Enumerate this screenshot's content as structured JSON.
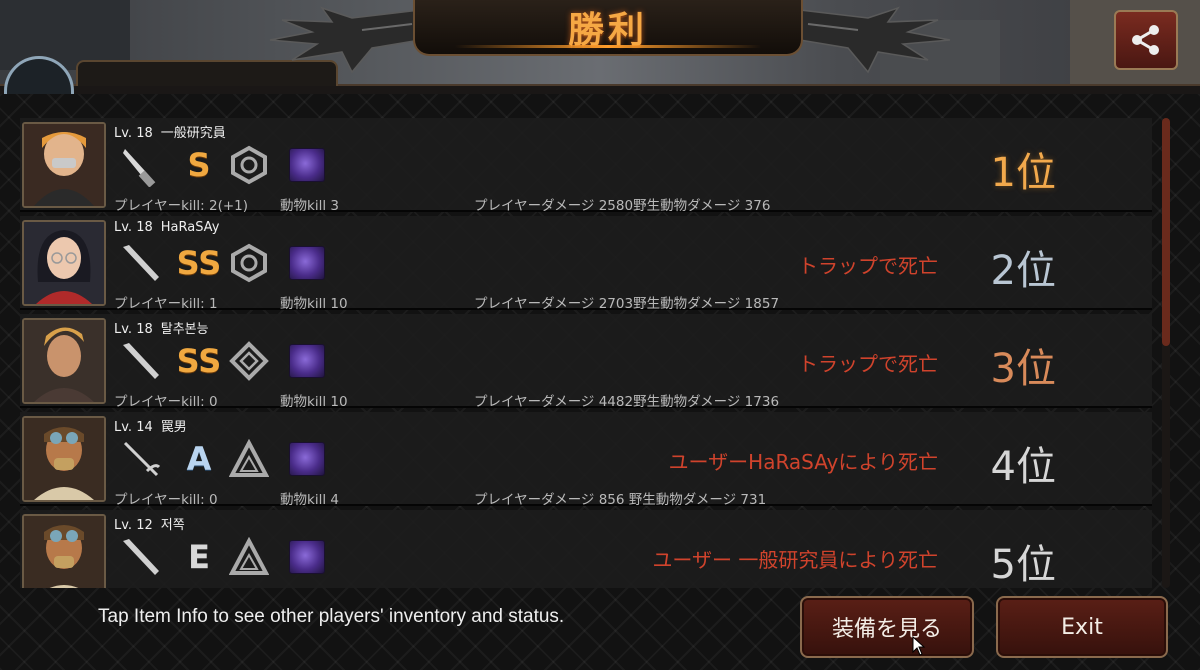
{
  "banner": {
    "title": "勝利"
  },
  "players": [
    {
      "level": "Lv. 18",
      "name": "一般研究員",
      "weapon_icon": "knife-icon",
      "grade": "S",
      "armor_icon": "hex-armor-icon",
      "pet_icon": "purple-beast-icon",
      "player_kill": "プレイヤーkill: 2(+1)",
      "animal_kill": "動物kill 3",
      "damage": "プレイヤーダメージ 2580野生動物ダメージ 376",
      "death": "",
      "rank": "1位"
    },
    {
      "level": "Lv. 18",
      "name": "HaRaSAy",
      "weapon_icon": "bat-icon",
      "grade": "SS",
      "armor_icon": "hex-armor-icon",
      "pet_icon": "purple-beast-icon",
      "player_kill": "プレイヤーkill: 1",
      "animal_kill": "動物kill 10",
      "damage": "プレイヤーダメージ 2703野生動物ダメージ 1857",
      "death": "トラップで死亡",
      "rank": "2位"
    },
    {
      "level": "Lv. 18",
      "name": "탈추본능",
      "weapon_icon": "bat-icon",
      "grade": "SS",
      "armor_icon": "diamond-armor-icon",
      "pet_icon": "purple-beast-icon",
      "player_kill": "プレイヤーkill: 0",
      "animal_kill": "動物kill 10",
      "damage": "プレイヤーダメージ 4482野生動物ダメージ 1736",
      "death": "トラップで死亡",
      "rank": "3位"
    },
    {
      "level": "Lv. 14",
      "name": "罠男",
      "weapon_icon": "rapier-icon",
      "grade": "A",
      "armor_icon": "triangle-armor-icon",
      "pet_icon": "purple-beast-icon",
      "player_kill": "プレイヤーkill: 0",
      "animal_kill": "動物kill 4",
      "damage": "プレイヤーダメージ 856  野生動物ダメージ 731",
      "death": "ユーザーHaRaSAyにより死亡",
      "rank": "4位"
    },
    {
      "level": "Lv. 12",
      "name": "저쪽",
      "weapon_icon": "bat-icon",
      "grade": "E",
      "armor_icon": "triangle-armor-icon",
      "pet_icon": "purple-beast-icon",
      "player_kill": "",
      "animal_kill": "",
      "damage": "",
      "death": "ユーザー 一般研究員により死亡",
      "rank": "5位"
    }
  ],
  "footer": {
    "hint": "Tap Item Info to see other players' inventory and status.",
    "equip_label": "装備を見る",
    "exit_label": "Exit"
  },
  "colors": {
    "rank_gold": "#f2a94c",
    "death_red": "#d0432c",
    "button_red": "#5a1f16",
    "grade_gold": "#f0a840"
  }
}
